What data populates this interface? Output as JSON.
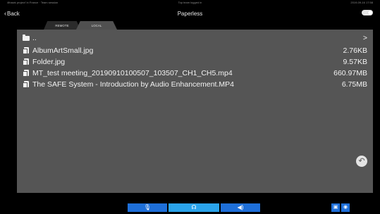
{
  "status": {
    "left": "4thawk project' in France · Team session",
    "center": "Top team logged in",
    "right": "2019-09-16 17:58"
  },
  "topbar": {
    "back_label": "Back",
    "title": "Paperless"
  },
  "tabs": [
    {
      "label": "REMOTE"
    },
    {
      "label": "LOCAL"
    }
  ],
  "files": [
    {
      "name": "..",
      "size": ">",
      "icon": "folder-icon"
    },
    {
      "name": "AlbumArtSmall.jpg",
      "size": "2.76KB",
      "icon": "file-icon"
    },
    {
      "name": "Folder.jpg",
      "size": "9.57KB",
      "icon": "file-icon"
    },
    {
      "name": "MT_test meeting_20190910100507_103507_CH1_CH5.mp4",
      "size": "660.97MB",
      "icon": "file-icon"
    },
    {
      "name": "The SAFE System - Introduction by Audio Enhancement.MP4",
      "size": "6.75MB",
      "icon": "file-icon"
    }
  ],
  "colors": {
    "panel": "#555555",
    "accent_blue": "#1e6fd9",
    "active_blue": "#2aa3ea"
  }
}
